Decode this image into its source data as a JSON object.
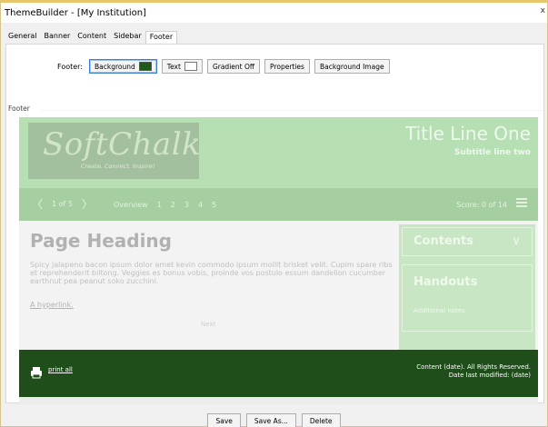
{
  "window": {
    "title": "ThemeBuilder - [My Institution]",
    "close_glyph": "x"
  },
  "tabs": [
    "General",
    "Banner",
    "Content",
    "Sidebar",
    "Footer"
  ],
  "toolbar": {
    "label": "Footer:",
    "background_label": "Background",
    "background_swatch": "#1f5a1c",
    "text_label": "Text",
    "text_swatch": "#ffffff",
    "gradient_label": "Gradient Off",
    "properties_label": "Properties",
    "background_image_label": "Background Image"
  },
  "group": {
    "legend": "Footer"
  },
  "preview": {
    "logo_text": "SoftChalk",
    "logo_tagline": "Create. Connect. Inspire!",
    "title": "Title Line One",
    "subtitle": "Subtitle line two",
    "nav": {
      "prev": "〈",
      "pager": "1 of 5",
      "next": "〉",
      "overview": "Overview",
      "pages": [
        "1",
        "2",
        "3",
        "4",
        "5"
      ],
      "score": "Score: 0 of 14"
    },
    "page_heading": "Page Heading",
    "body_text": "Spicy jalapeno bacon ipsum dolor amet kevin commodo ipsum mollit brisket velit. Cupim spare ribs et reprehenderit biltong. Veggies es bonus vobis, proinde vos postulo essum dandelion cucumber earthnut pea peanut soko zucchini.",
    "hyperlink": "A hyperlink.",
    "next_text": "Next",
    "sidebar": {
      "contents_title": "Contents",
      "handouts_title": "Handouts",
      "handouts_note": "Additional notes"
    },
    "footer": {
      "print_label": "print all",
      "copyright_line1": "Content (date). All Rights Reserved.",
      "copyright_line2": "Date last modified: (date)"
    }
  },
  "actions": {
    "save": "Save",
    "save_as": "Save As...",
    "delete": "Delete"
  }
}
